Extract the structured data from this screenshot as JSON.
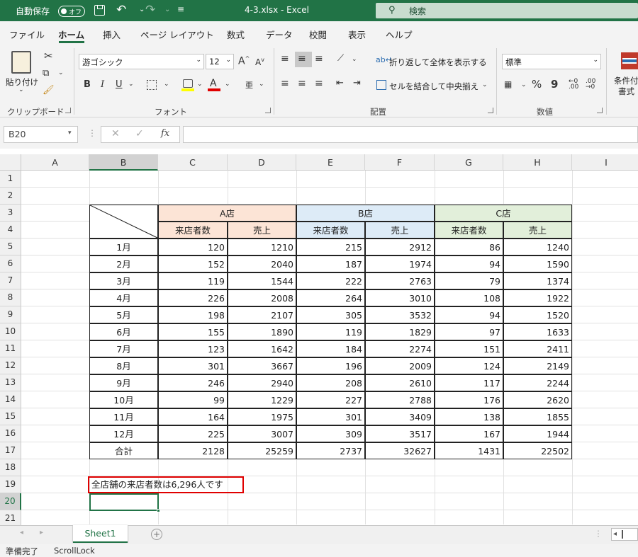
{
  "titlebar": {
    "autosave": "自動保存",
    "autosave_state": "オフ",
    "file_title": "4-3.xlsx  -  Excel",
    "search": "検索"
  },
  "tabs": [
    "ファイル",
    "ホーム",
    "挿入",
    "ページ レイアウト",
    "数式",
    "データ",
    "校閲",
    "表示",
    "ヘルプ"
  ],
  "ribbon": {
    "clipboard": {
      "paste": "貼り付け",
      "label": "クリップボード"
    },
    "font": {
      "name": "游ゴシック",
      "size": "12",
      "label": "フォント",
      "bold": "B",
      "italic": "I",
      "underline": "U"
    },
    "alignment": {
      "wrap": "折り返して全体を表示する",
      "merge": "セルを結合して中央揃え",
      "label": "配置"
    },
    "number": {
      "format": "標準",
      "label": "数値",
      "percent": "%",
      "comma": "9"
    },
    "styles": {
      "cond1": "条件付",
      "cond2": "書式"
    }
  },
  "formula_bar": {
    "name_box": "B20",
    "fx": "fx",
    "formula": ""
  },
  "columns": [
    "A",
    "B",
    "C",
    "D",
    "E",
    "F",
    "G",
    "H",
    "I"
  ],
  "rows": [
    "1",
    "2",
    "3",
    "4",
    "5",
    "6",
    "7",
    "8",
    "9",
    "10",
    "11",
    "12",
    "13",
    "14",
    "15",
    "16",
    "17",
    "18",
    "19",
    "20",
    "21"
  ],
  "table": {
    "stores": [
      "A店",
      "B店",
      "C店"
    ],
    "subheaders": [
      "来店者数",
      "売上",
      "来店者数",
      "売上",
      "来店者数",
      "売上"
    ],
    "months": [
      "1月",
      "2月",
      "3月",
      "4月",
      "5月",
      "6月",
      "7月",
      "8月",
      "9月",
      "10月",
      "11月",
      "12月",
      "合計"
    ],
    "data": [
      [
        "120",
        "1210",
        "215",
        "2912",
        "86",
        "1240"
      ],
      [
        "152",
        "2040",
        "187",
        "1974",
        "94",
        "1590"
      ],
      [
        "119",
        "1544",
        "222",
        "2763",
        "79",
        "1374"
      ],
      [
        "226",
        "2008",
        "264",
        "3010",
        "108",
        "1922"
      ],
      [
        "198",
        "2107",
        "305",
        "3532",
        "94",
        "1520"
      ],
      [
        "155",
        "1890",
        "119",
        "1829",
        "97",
        "1633"
      ],
      [
        "123",
        "1642",
        "184",
        "2274",
        "151",
        "2411"
      ],
      [
        "301",
        "3667",
        "196",
        "2009",
        "124",
        "2149"
      ],
      [
        "246",
        "2940",
        "208",
        "2610",
        "117",
        "2244"
      ],
      [
        "99",
        "1229",
        "227",
        "2788",
        "176",
        "2620"
      ],
      [
        "164",
        "1975",
        "301",
        "3409",
        "138",
        "1855"
      ],
      [
        "225",
        "3007",
        "309",
        "3517",
        "167",
        "1944"
      ],
      [
        "2128",
        "25259",
        "2737",
        "32627",
        "1431",
        "22502"
      ]
    ],
    "note": "全店舗の来店者数は6,296人です"
  },
  "colors": {
    "accent": "#217346",
    "storeA": "#fce4d6",
    "storeB": "#ddebf7",
    "storeC": "#e2efda",
    "note_border": "#e00000"
  },
  "sheet": {
    "tab": "Sheet1"
  },
  "status": {
    "ready": "準備完了",
    "scroll": "ScrollLock"
  }
}
